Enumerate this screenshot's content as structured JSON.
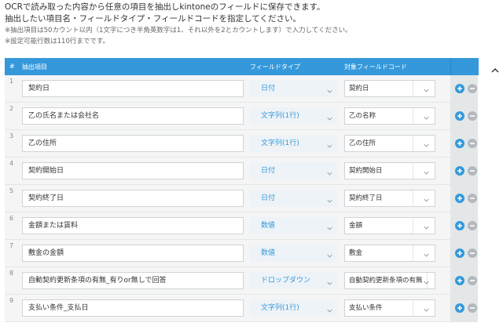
{
  "intro": {
    "line1": "OCRで読み取った内容から任意の項目を抽出しkintoneのフィールドに保存できます。",
    "line2": "抽出したい項目名・フィールドタイプ・フィールドコードを指定してください。",
    "note1": "※抽出項目は50カウント以内（1文字につき半角英数字は1、それ以外を2とカウントします）で入力してください。",
    "note2": "※設定可能行数は110行までです。"
  },
  "table": {
    "headers": {
      "num": "#",
      "item": "抽出項目",
      "field_type": "フィールドタイプ",
      "field_code": "対象フィールドコード"
    },
    "rows": [
      {
        "num": "1",
        "item": "契約日",
        "field_type": "日付",
        "field_code": "契約日"
      },
      {
        "num": "2",
        "item": "乙の氏名または会社名",
        "field_type": "文字列(1行)",
        "field_code": "乙の名称"
      },
      {
        "num": "3",
        "item": "乙の住所",
        "field_type": "文字列(1行)",
        "field_code": "乙の住所"
      },
      {
        "num": "4",
        "item": "契約開始日",
        "field_type": "日付",
        "field_code": "契約開始日"
      },
      {
        "num": "5",
        "item": "契約終了日",
        "field_type": "日付",
        "field_code": "契約終了日"
      },
      {
        "num": "6",
        "item": "金額または賃料",
        "field_type": "数値",
        "field_code": "金額"
      },
      {
        "num": "7",
        "item": "敷金の金額",
        "field_type": "数値",
        "field_code": "敷金"
      },
      {
        "num": "8",
        "item": "自動契約更新条項の有無_有りor無しで回答",
        "field_type": "ドロップダウン",
        "field_code": "自動契約更新条項の有無"
      },
      {
        "num": "9",
        "item": "支払い条件_支払日",
        "field_type": "文字列(1行)",
        "field_code": "支払い条件"
      }
    ]
  },
  "icons": {
    "add": "plus-circle-icon",
    "remove": "minus-circle-icon",
    "dropdown": "chevron-down-icon",
    "collapse": "chevron-up-icon"
  },
  "colors": {
    "accent": "#3598db",
    "row_bg": "#f5f5f5",
    "action_col_bg": "#e3e7e8",
    "remove_disabled": "#b3b8bc"
  }
}
